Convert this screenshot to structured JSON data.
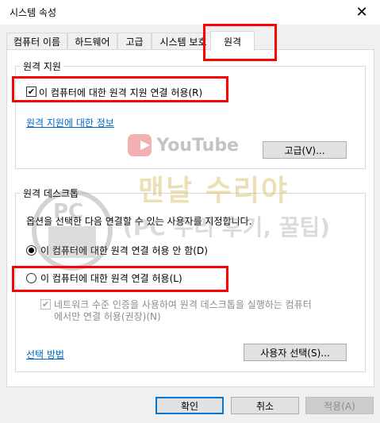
{
  "window": {
    "title": "시스템 속성",
    "close_icon": "close-icon"
  },
  "tabs": [
    {
      "label": "컴퓨터 이름"
    },
    {
      "label": "하드웨어"
    },
    {
      "label": "고급"
    },
    {
      "label": "시스템 보호"
    },
    {
      "label": "원격",
      "active": true
    }
  ],
  "remote_assistance": {
    "group_label": "원격 지원",
    "allow_checkbox": {
      "label": "이 컴퓨터에 대한 원격 지원 연결 허용(R)",
      "checked": true
    },
    "info_link": "원격 지원에 대한 정보",
    "advanced_button": "고급(V)..."
  },
  "remote_desktop": {
    "group_label": "원격 데스크톱",
    "description": "옵션을 선택한 다음 연결할 수 있는 사용자를 지정합니다.",
    "option_deny": {
      "label": "이 컴퓨터에 대한 원격 연결 허용 안 함(D)",
      "checked": true
    },
    "option_allow": {
      "label": "이 컴퓨터에 대한 원격 연결 허용(L)",
      "checked": false
    },
    "nla_checkbox": {
      "line1": "네트워크 수준 인증을 사용하여 원격 데스크톱을 실행하는 컴퓨터",
      "line2": "에서만 연결 허용(권장)(N)",
      "checked": true,
      "disabled": true
    },
    "choose_link": "선택 방법",
    "select_users_button": "사용자 선택(S)..."
  },
  "footer": {
    "ok": "확인",
    "cancel": "취소",
    "apply": "적용(A)"
  },
  "watermark": {
    "pc_text": "PC",
    "youtube_text": "YouTube",
    "big_text": "맨날 수리야",
    "sub_text": "(PC 수리 후기, 꿀팁)"
  },
  "colors": {
    "highlight_box": "#ff0000",
    "link": "#0066cc",
    "default_button_border": "#0078d7"
  }
}
